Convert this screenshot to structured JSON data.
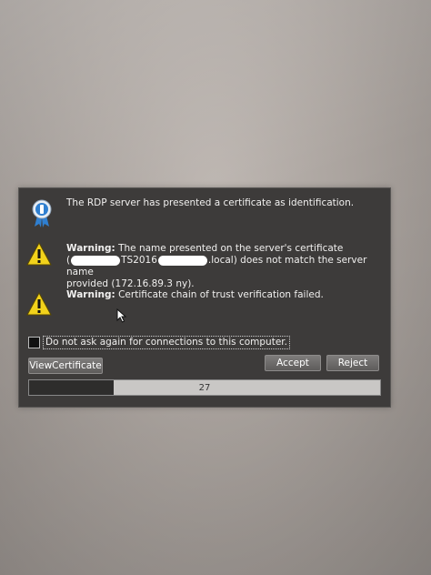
{
  "dialog": {
    "info_message": "The RDP server has presented a certificate as identification.",
    "warning1": {
      "label": "Warning:",
      "line1": "The name presented on the server's certificate",
      "line2_open": "(",
      "line2_mid": "TS2016",
      "line2_end": ".local) does not match the server name",
      "line3": "provided (172.16.89.3 ny)."
    },
    "warning2": {
      "label": "Warning:",
      "text": "Certificate chain of trust verification failed."
    },
    "checkbox_label": "Do not ask again for connections to this computer.",
    "checkbox_checked": false,
    "buttons": {
      "view_certificate": "ViewCertificate",
      "accept": "Accept",
      "reject": "Reject"
    },
    "progress": {
      "countdown_text": "27",
      "fill_fraction": 0.24
    }
  },
  "colors": {
    "dialog_bg": "#3d3b3a",
    "warning_yellow": "#f2d21b",
    "info_blue": "#2f7fd0"
  },
  "icons": [
    "certificate-ribbon-icon",
    "warning-triangle-icon",
    "mouse-cursor-icon"
  ]
}
